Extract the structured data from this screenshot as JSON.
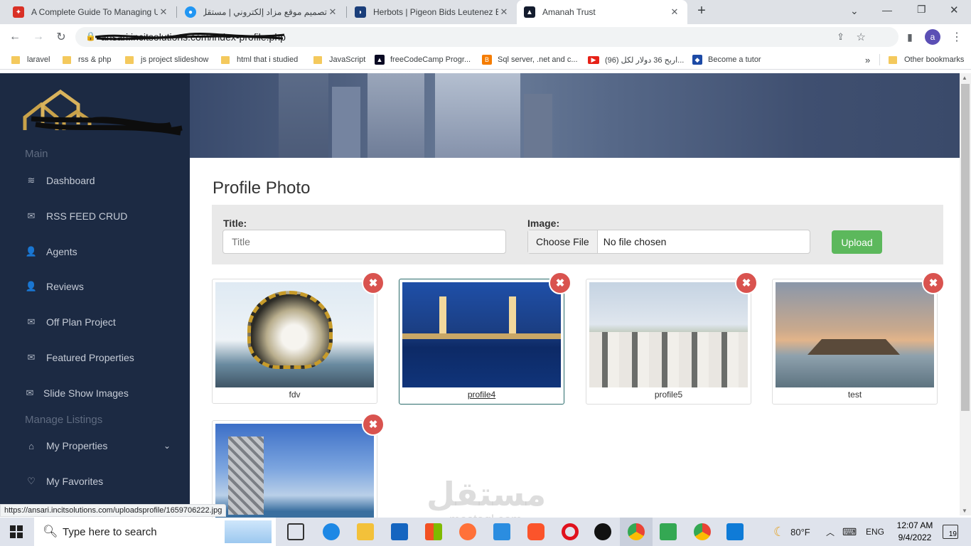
{
  "browser": {
    "tabs": [
      {
        "title": "A Complete Guide To Managing Use",
        "favicon": "code-icon"
      },
      {
        "title": "تصميم موقع مزاد إلكتروني | مستقل",
        "favicon": "mostaql-icon"
      },
      {
        "title": "Herbots | Pigeon Bids Leutenez Edd",
        "favicon": "herbots-icon"
      },
      {
        "title": "Amanah Trust",
        "favicon": "amanah-icon"
      }
    ],
    "new_tab": "+",
    "url": "ansari.incitsolutions.com/index-profile.php",
    "profile_initial": "a",
    "bookmarks": [
      "laravel",
      "rss & php",
      "js project slideshow",
      "html that i studied",
      "JavaScript",
      "freeCodeCamp Progr...",
      "Sql server, .net and c...",
      "(96) اربح 36 دولار لكل...",
      "Become a tutor"
    ],
    "more_bookmarks": "»",
    "other_bookmarks": "Other bookmarks",
    "status_url": "https://ansari.incitsolutions.com/uploadsprofile/1659706222.jpg"
  },
  "sidebar": {
    "section_main": "Main",
    "items": [
      {
        "label": "Dashboard",
        "icon": "layers-icon"
      },
      {
        "label": "RSS FEED CRUD",
        "icon": "mail-icon"
      },
      {
        "label": "Agents",
        "icon": "user-icon"
      },
      {
        "label": "Reviews",
        "icon": "user-icon"
      },
      {
        "label": "Off Plan Project",
        "icon": "mail-icon"
      },
      {
        "label": "Featured Properties",
        "icon": "mail-icon"
      },
      {
        "label": "Slide Show Images",
        "icon": "mail-icon"
      }
    ],
    "section_listings": "Manage Listings",
    "listings": [
      {
        "label": "My Properties",
        "icon": "home-icon"
      },
      {
        "label": "My Favorites",
        "icon": "heart-icon"
      }
    ]
  },
  "main": {
    "title": "Profile Photo",
    "form": {
      "title_label": "Title:",
      "title_placeholder": "Title",
      "image_label": "Image:",
      "choose_file": "Choose File",
      "no_file": "No file chosen",
      "upload": "Upload"
    },
    "photos": [
      {
        "caption": "fdv"
      },
      {
        "caption": "profile4"
      },
      {
        "caption": "profile5"
      },
      {
        "caption": "test"
      },
      {
        "caption": ""
      }
    ]
  },
  "watermark": {
    "ar": "مستقل",
    "en": "mostaql.com"
  },
  "taskbar": {
    "search_placeholder": "Type here to search",
    "weather": "80°F",
    "language": "ENG",
    "time": "12:07 AM",
    "date": "9/4/2022",
    "notifications": "19"
  }
}
